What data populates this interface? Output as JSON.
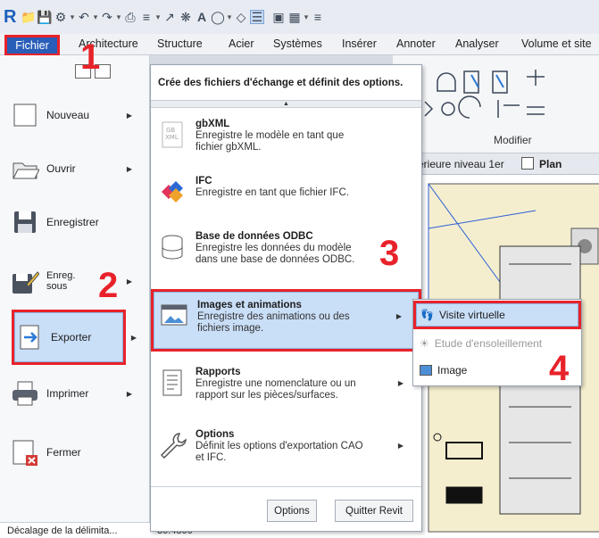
{
  "quick_access": {
    "app_logo": "R",
    "icons": [
      "open-icon",
      "save-icon",
      "sync-icon",
      "undo-icon",
      "redo-icon",
      "print-icon",
      "measure-icon",
      "dimension-icon",
      "tag-icon",
      "text-icon",
      "3d-view-icon",
      "section-icon",
      "thin-lines-icon",
      "close-windows-icon",
      "switch-windows-icon",
      "customize-icon"
    ]
  },
  "ribbon": {
    "fichier_tab": "Fichier",
    "tabs": [
      "Architecture",
      "Structure",
      "Acier",
      "Systèmes",
      "Insérer",
      "Annoter",
      "Analyser",
      "Volume et site"
    ],
    "panel_label": "Modifier"
  },
  "view_tabs": [
    "érieure niveau 1er",
    "Plan"
  ],
  "left_menu": {
    "items": [
      {
        "label": "Nouveau",
        "has_arrow": true
      },
      {
        "label": "Ouvrir",
        "has_arrow": true
      },
      {
        "label": "Enregistrer",
        "has_arrow": false
      },
      {
        "label": "Enreg. sous",
        "has_arrow": true
      },
      {
        "label": "Exporter",
        "has_arrow": true
      },
      {
        "label": "Imprimer",
        "has_arrow": true
      },
      {
        "label": "Fermer",
        "has_arrow": false
      }
    ]
  },
  "export_menu": {
    "header": "Crée des fichiers d'échange et définit des options.",
    "items": [
      {
        "title": "gbXML",
        "desc": "Enregistre le modèle en tant que fichier gbXML."
      },
      {
        "title": "IFC",
        "desc": "Enregistre en tant que fichier IFC."
      },
      {
        "title": "Base de données ODBC",
        "desc": "Enregistre les données du modèle dans une base de données ODBC."
      },
      {
        "title": "Images et animations",
        "desc": "Enregistre des animations ou des fichiers image."
      },
      {
        "title": "Rapports",
        "desc": "Enregistre une nomenclature ou un rapport sur les pièces/surfaces."
      },
      {
        "title": "Options",
        "desc": "Définit les options d'exportation CAO et IFC."
      }
    ],
    "buttons": {
      "options": "Options",
      "quit": "Quitter Revit"
    }
  },
  "images_flyout": {
    "items": [
      {
        "label": "Visite virtuelle",
        "state": "highlighted"
      },
      {
        "label": "Etude d'ensoleillement",
        "state": "disabled"
      },
      {
        "label": "Image",
        "state": "normal"
      }
    ]
  },
  "properties_row": {
    "name": "Décalage de la délimita...",
    "value": "30.4800"
  },
  "steps": [
    "1",
    "2",
    "3",
    "4"
  ],
  "colors": {
    "accent": "#2a5db8",
    "highlight": "#c9def7",
    "annotation": "#e8222a"
  }
}
